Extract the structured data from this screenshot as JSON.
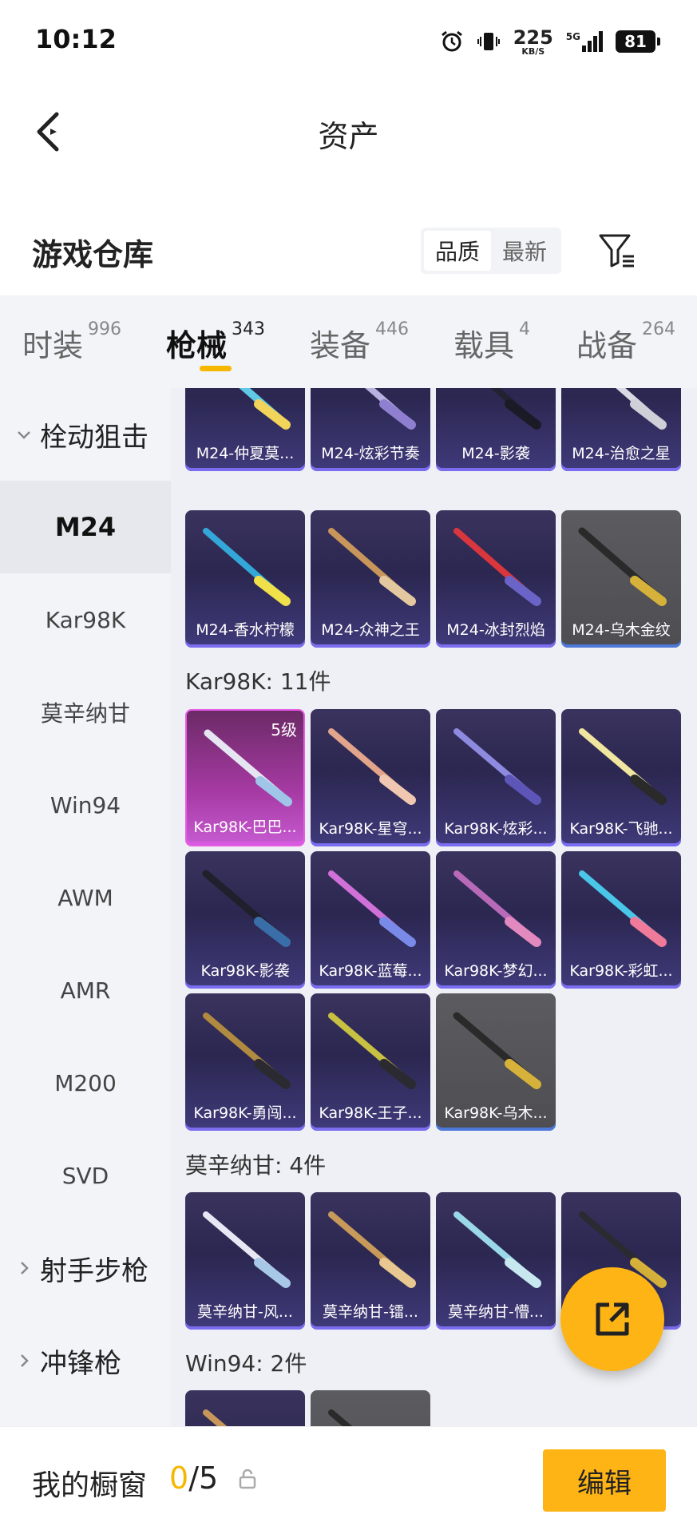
{
  "status_bar": {
    "time": "10:12",
    "net_speed": "225",
    "net_unit": "KB/S",
    "network": "5G",
    "battery": "81"
  },
  "nav": {
    "title": "资产"
  },
  "section": {
    "title": "游戏仓库",
    "sort_options": [
      "品质",
      "最新"
    ],
    "sort_selected": "品质"
  },
  "tabs": [
    {
      "label": "时装",
      "count": "996"
    },
    {
      "label": "枪械",
      "count": "343",
      "active": true
    },
    {
      "label": "装备",
      "count": "446"
    },
    {
      "label": "载具",
      "count": "4"
    },
    {
      "label": "战备",
      "count": "264"
    }
  ],
  "sidebar": {
    "group1": "栓动狙击",
    "items": [
      "M24",
      "Kar98K",
      "莫辛纳甘",
      "Win94",
      "AWM",
      "AMR",
      "M200",
      "SVD"
    ],
    "active": "M24",
    "group2": "射手步枪",
    "group3": "冲锋枪"
  },
  "categories": {
    "m24_items": [
      "M24-仲夏莫...",
      "M24-炫彩节奏",
      "M24-影袭",
      "M24-治愈之星",
      "M24-香水柠檬",
      "M24-众神之王",
      "M24-冰封烈焰",
      "M24-乌木金纹"
    ],
    "kar98k_header": "Kar98K: 11件",
    "kar98k_items": [
      "Kar98K-巴巴...",
      "Kar98K-星穹...",
      "Kar98K-炫彩...",
      "Kar98K-飞驰...",
      "Kar98K-影袭",
      "Kar98K-蓝莓...",
      "Kar98K-梦幻...",
      "Kar98K-彩虹...",
      "Kar98K-勇闯...",
      "Kar98K-王子...",
      "Kar98K-乌木..."
    ],
    "kar98k_level": "5级",
    "mosin_header": "莫辛纳甘: 4件",
    "mosin_items": [
      "莫辛纳甘-风...",
      "莫辛纳甘-镭...",
      "莫辛纳甘-懵...",
      ""
    ],
    "win94_header": "Win94: 2件"
  },
  "bottom": {
    "showcase_label": "我的橱窗",
    "showcase_current": "0",
    "showcase_total": "/5",
    "edit_label": "编辑"
  },
  "colors": {
    "accent": "#fdb414",
    "card_purple": "#2b2750",
    "card_gray": "#4e4e52",
    "card_pink": "#a63aa3"
  }
}
